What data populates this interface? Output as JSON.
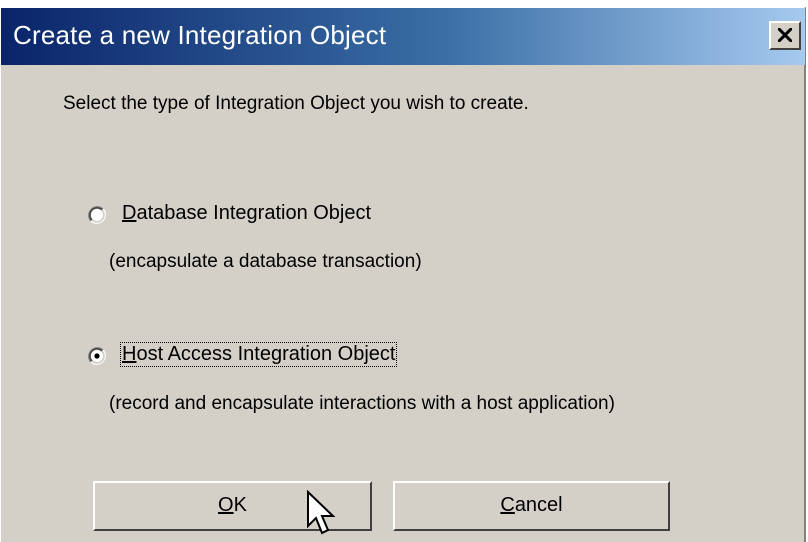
{
  "window": {
    "title": "Create a new Integration Object",
    "close_glyph": "X"
  },
  "instruction": "Select the type of Integration Object you wish to create.",
  "options": [
    {
      "label": "Database Integration Object",
      "mnemonic": "D",
      "label_rest": "atabase Integration Object",
      "description": "(encapsulate a database transaction)",
      "selected": false
    },
    {
      "label": "Host Access Integration Object",
      "mnemonic": "H",
      "label_rest": "ost Access Integration Object",
      "description": "(record and encapsulate interactions with a host application)",
      "selected": true
    }
  ],
  "buttons": {
    "ok": {
      "label": "OK",
      "mnemonic": "O",
      "rest": "K"
    },
    "cancel": {
      "label": "Cancel",
      "mnemonic": "C",
      "rest": "ancel"
    }
  },
  "colors": {
    "titlebar_start": "#0a246a",
    "titlebar_end": "#a6caf0",
    "dialog_face": "#d4d0c8"
  },
  "icons": {
    "close": "close-icon",
    "cursor": "mouse-pointer-icon"
  }
}
